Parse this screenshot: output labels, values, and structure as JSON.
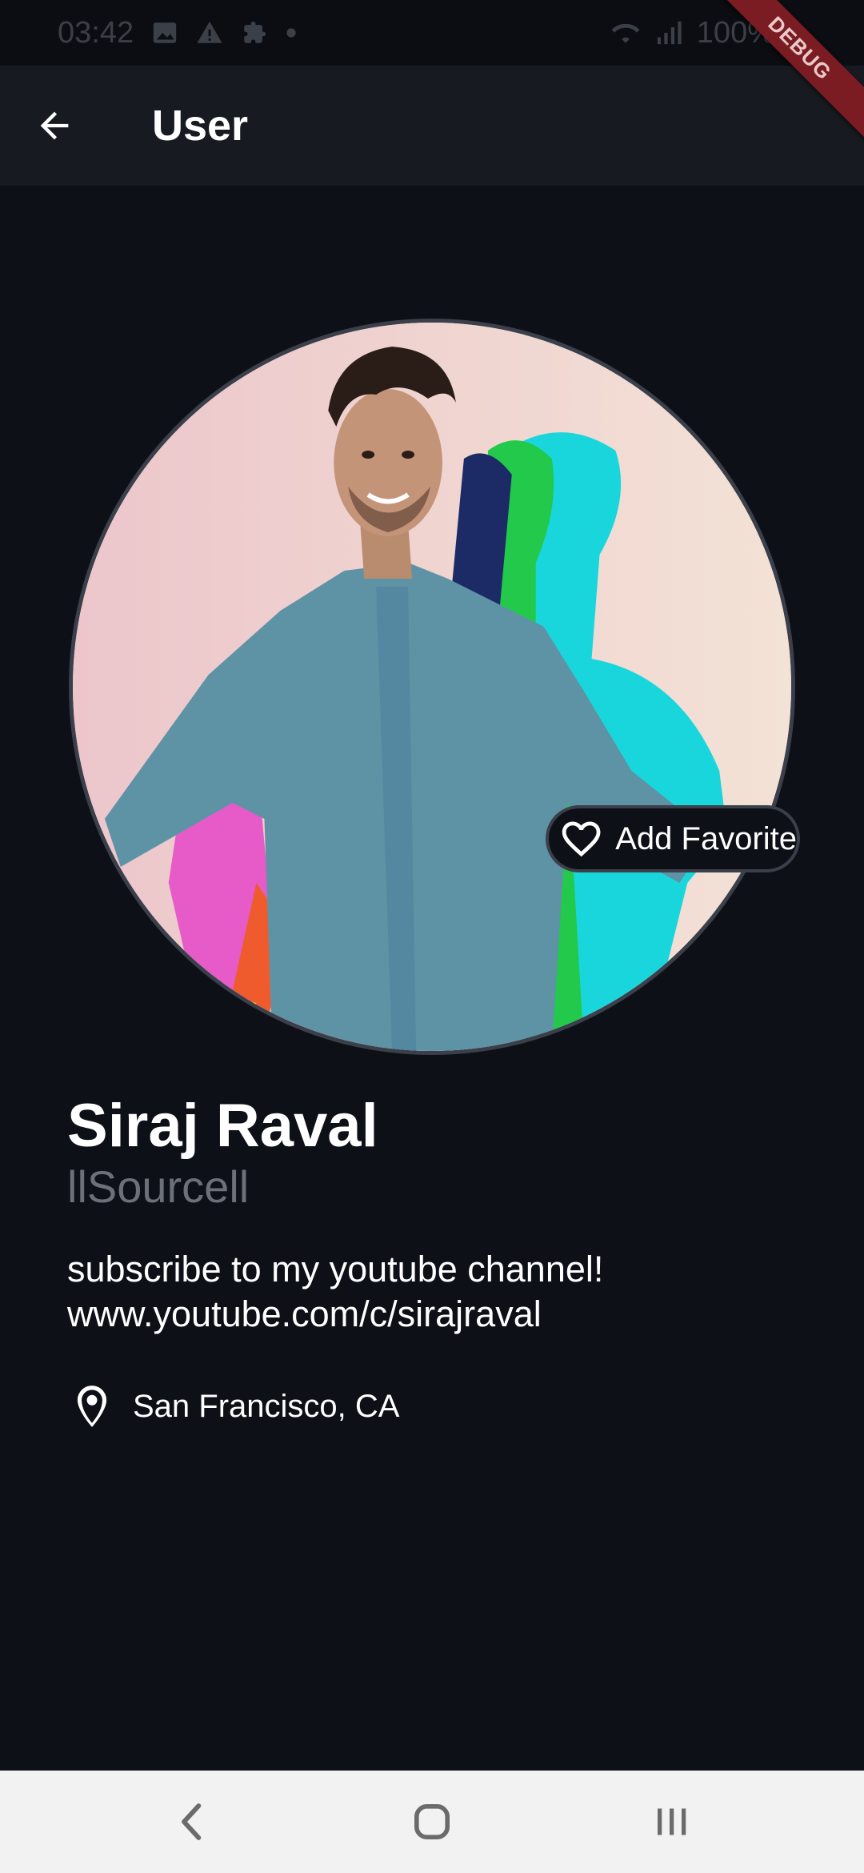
{
  "status_bar": {
    "time": "03:42",
    "battery": "100%",
    "icons": [
      "image-icon",
      "warning-icon",
      "puzzle-icon",
      "dot-icon",
      "wifi-icon",
      "signal-icon"
    ]
  },
  "debug_banner": "DEBUG",
  "app_bar": {
    "title": "User",
    "back_icon": "arrow-left-icon"
  },
  "profile": {
    "favorite_label": "Add Favorite",
    "favorite_icon": "heart-outline-icon",
    "name": "Siraj Raval",
    "handle": "llSourcell",
    "bio": [
      "subscribe to my youtube channel!",
      "www.youtube.com/c/sirajraval"
    ],
    "location": "San Francisco, CA",
    "location_icon": "map-pin-icon"
  },
  "nav_bar": {
    "icons": [
      "nav-back-icon",
      "nav-home-icon",
      "nav-recents-icon"
    ]
  },
  "colors": {
    "background": "#0d1017",
    "app_bar": "#171a21",
    "handle_text": "#6c7079",
    "avatar_border": "#3a3f4a",
    "nav_bar": "#f2f2f2"
  }
}
